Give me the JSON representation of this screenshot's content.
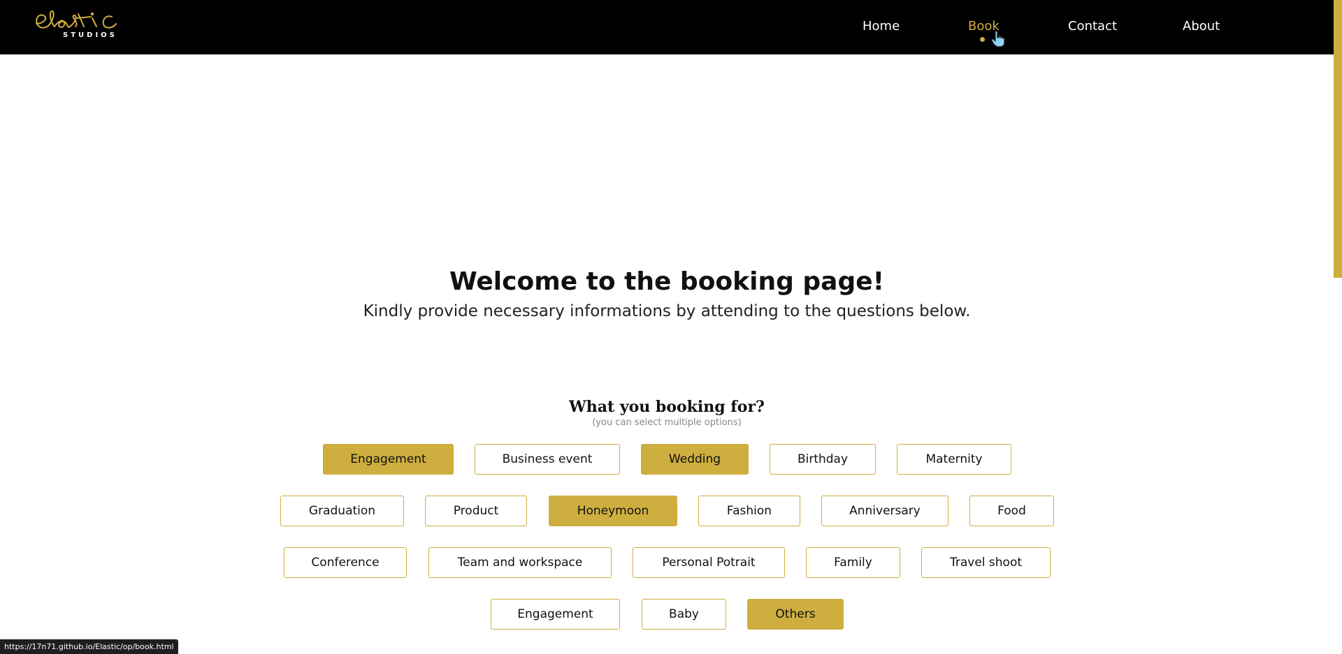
{
  "brand": {
    "logo_script": "elastic",
    "logo_sub": "STUDIOS",
    "accent_color": "#cdae3f"
  },
  "nav": {
    "items": [
      {
        "label": "Home",
        "active": false
      },
      {
        "label": "Book",
        "active": true
      },
      {
        "label": "Contact",
        "active": false
      },
      {
        "label": "About",
        "active": false
      }
    ]
  },
  "main": {
    "title": "Welcome to the booking page!",
    "subtitle": "Kindly provide necessary informations by attending to the questions below."
  },
  "question": {
    "title": "What you booking for?",
    "hint": "(you can select multiple options)",
    "rows": [
      [
        {
          "label": "Engagement",
          "selected": true
        },
        {
          "label": "Business event",
          "selected": false
        },
        {
          "label": "Wedding",
          "selected": true
        },
        {
          "label": "Birthday",
          "selected": false
        },
        {
          "label": "Maternity",
          "selected": false
        }
      ],
      [
        {
          "label": "Graduation",
          "selected": false
        },
        {
          "label": "Product",
          "selected": false
        },
        {
          "label": "Honeymoon",
          "selected": true
        },
        {
          "label": "Fashion",
          "selected": false
        },
        {
          "label": "Anniversary",
          "selected": false
        },
        {
          "label": "Food",
          "selected": false
        }
      ],
      [
        {
          "label": "Conference",
          "selected": false
        },
        {
          "label": "Team and workspace",
          "selected": false
        },
        {
          "label": "Personal Potrait",
          "selected": false
        },
        {
          "label": "Family",
          "selected": false
        },
        {
          "label": "Travel shoot",
          "selected": false
        }
      ],
      [
        {
          "label": "Engagement",
          "selected": false
        },
        {
          "label": "Baby",
          "selected": false
        },
        {
          "label": "Others",
          "selected": true
        }
      ]
    ]
  },
  "status_bar": {
    "url": "https://17n71.github.io/Elastic/op/book.html"
  }
}
